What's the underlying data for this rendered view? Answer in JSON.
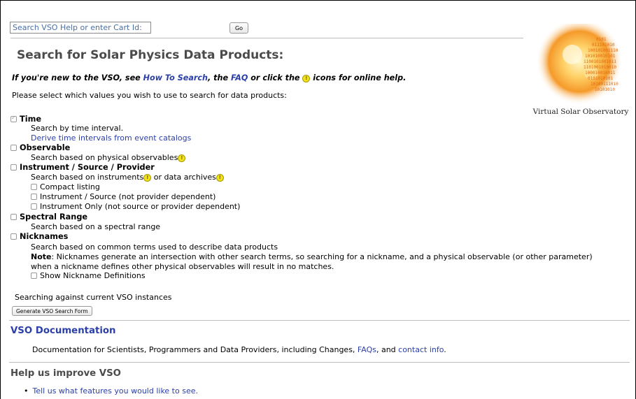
{
  "search": {
    "placeholder": "Search VSO Help or enter Cart Id:",
    "go_label": "Go"
  },
  "logo": {
    "caption": "Virtual Solar Observatory",
    "binary_text": "0101011101010100101001110101001010110011010101010101001101"
  },
  "header": {
    "title": "Search for Solar Physics Data Products:",
    "intro_prefix": "If you're new to the VSO, see ",
    "how_to_link": "How To Search",
    "intro_mid": ", the ",
    "faq_link": "FAQ",
    "intro_mid2": " or click the ",
    "intro_suffix": " icons for online help.",
    "select_prompt": "Please select which values you wish to use to search for data products:"
  },
  "options": {
    "time": {
      "label": "Time",
      "desc": "Search by time interval.",
      "link": "Derive time intervals from event catalogs",
      "checked": true
    },
    "observable": {
      "label": "Observable",
      "desc": "Search based on physical observables"
    },
    "instrument": {
      "label": "Instrument / Source / Provider",
      "desc_prefix": "Search based on instruments",
      "desc_mid": " or data archives",
      "sub": [
        "Compact listing",
        "Instrument / Source (not provider dependent)",
        "Instrument Only (not source or provider dependent)"
      ]
    },
    "spectral": {
      "label": "Spectral Range",
      "desc": "Search based on a spectral range"
    },
    "nicknames": {
      "label": "Nicknames",
      "desc": "Search based on common terms used to describe data products",
      "note_label": "Note",
      "note_line1": ": Nicknames generate an intersection with other search terms, so searching for a nickname, and a physical observable (or other parameter)",
      "note_line2": "when a nickname defines other physical observables will result in no matches.",
      "show_defs": "Show Nickname Definitions"
    }
  },
  "instances_text": "Searching against current VSO instances",
  "generate_button": "Generate VSO Search Form",
  "documentation": {
    "heading": "VSO Documentation",
    "text_prefix": "Documentation for Scientists, Programmers and Data Providers, including Changes, ",
    "faqs_link": "FAQs",
    "text_mid": ", and ",
    "contact_link": "contact info",
    "text_suffix": "."
  },
  "improve": {
    "heading": "Help us improve VSO",
    "items": [
      "Tell us what features you would like to see."
    ]
  },
  "colors": {
    "link": "#2b3fa8",
    "doc_heading": "#2b3fa8",
    "help_icon": "#f2e21a"
  }
}
